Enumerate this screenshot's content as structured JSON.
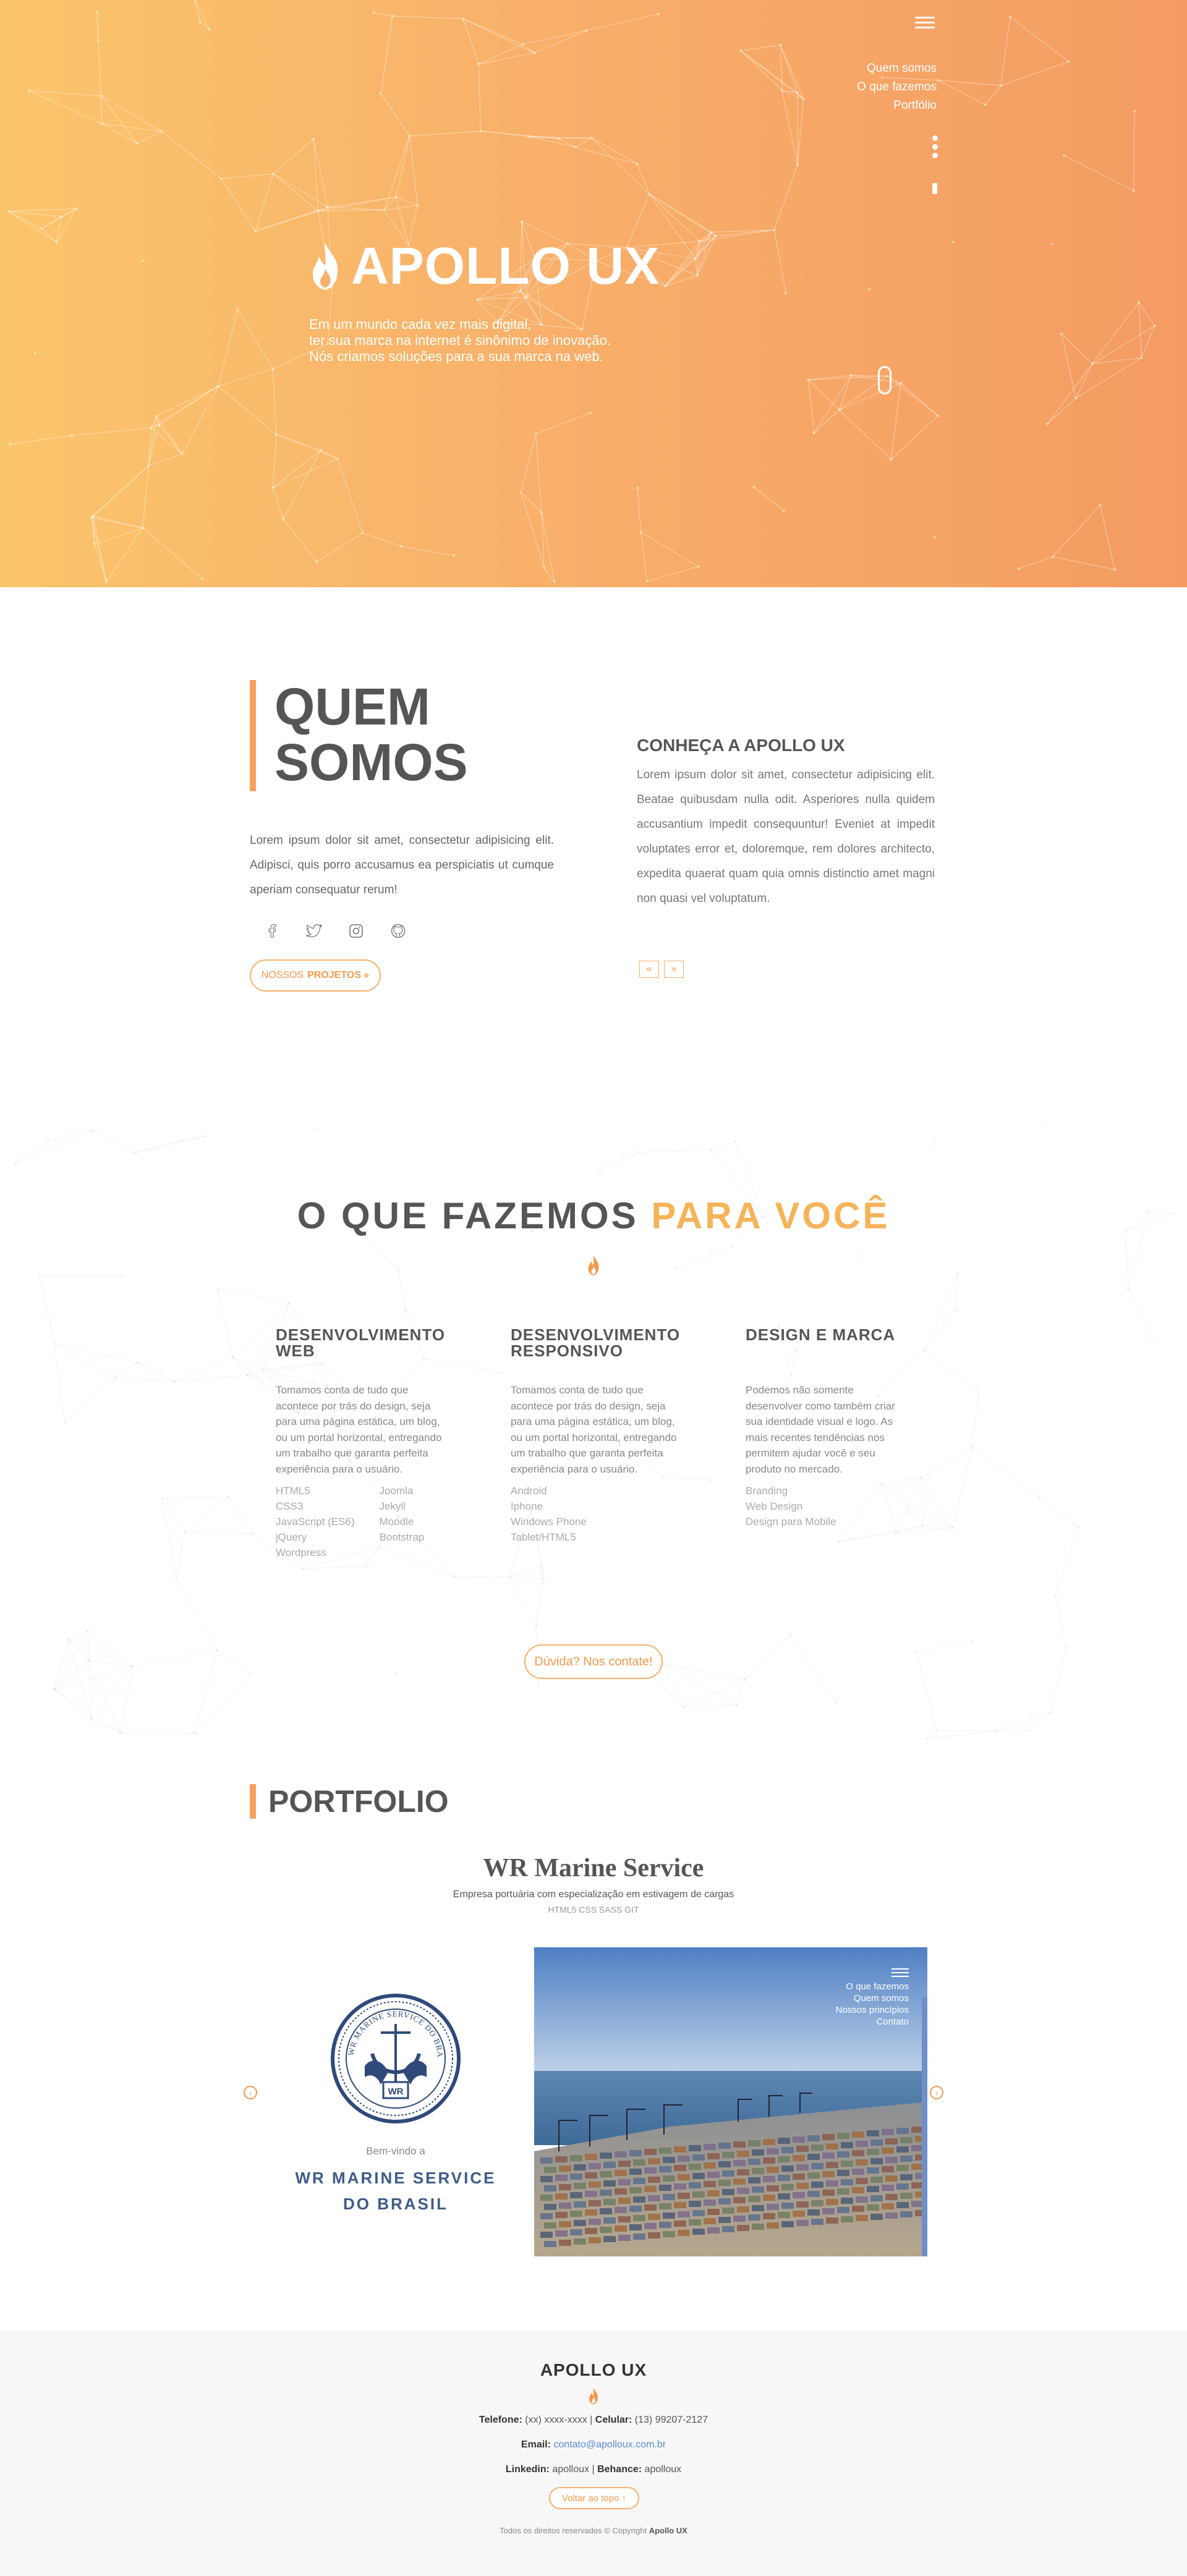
{
  "hero": {
    "brand": "APOLLO UX",
    "nav": [
      "Quem somos",
      "O que fazemos",
      "Portfólio"
    ],
    "lines": [
      "Em um mundo cada vez mais digital,",
      "ter sua marca na internet é sinônimo de inovação.",
      "Nós criamos soluções para a sua marca na web."
    ]
  },
  "about": {
    "title_line1": "QUEM",
    "title_line2": "SOMOS",
    "text": "Lorem ipsum dolor sit amet, consectetur adipisicing elit. Adipisci, quis porro accusamus ea perspiciatis ut cumque aperiam consequatur rerum!",
    "button_prefix": "NOSSOS",
    "button_label": "PROJETOS »",
    "right_title": "CONHEÇA A APOLLO UX",
    "right_text": "Lorem ipsum dolor sit amet, consectetur adipisicing elit. Beatae quibusdam nulla odit. Asperiores nulla quidem accusantium impedit consequuntur! Eveniet at impedit voluptates error et, doloremque, rem dolores architecto, expedita quaerat quam quia omnis distinctio amet magni non quasi vel voluptatum.",
    "prev": "«",
    "next": "»"
  },
  "services": {
    "title": "O QUE FAZEMOS",
    "title_accent": "PARA VOCÊ",
    "columns": [
      {
        "heading": "DESENVOLVIMENTO WEB",
        "text": "Tomamos conta de tudo que acontece por trás do design, seja para uma página estática, um blog, ou um portal horizontal, entregando um trabalho que garanta perfeita experiência para o usuário.",
        "list_a": [
          "HTML5",
          "CSS3",
          "JavaScript (ES6)",
          "jQuery",
          "Wordpress"
        ],
        "list_b": [
          "Joomla",
          "Jekyll",
          "Moodle",
          "Bootstrap"
        ]
      },
      {
        "heading": "DESENVOLVIMENTO RESPONSIVO",
        "text": "Tomamos conta de tudo que acontece por trás do design, seja para uma página estática, um blog, ou um portal horizontal, entregando um trabalho que garanta perfeita experiência para o usuário.",
        "list_a": [
          "Android",
          "Iphone",
          "Windows Phone",
          "Tablet/HTML5"
        ]
      },
      {
        "heading": "DESIGN E MARCA",
        "text": "Podemos não somente desenvolver como também criar sua identidade visual e logo. As mais recentes tendências nos permitem ajudar você e seu produto no mercado.",
        "list_a": [
          "Branding",
          "Web Design",
          "Design para Mobile"
        ]
      }
    ],
    "button": "Dúvida? Nos contate!"
  },
  "portfolio": {
    "title": "PORTFOLIO",
    "project_name": "WR Marine Service",
    "project_desc": "Empresa portuária com especialização em estivagem de cargas",
    "project_tags": "HTML5 CSS SASS GIT",
    "welcome": "Bem-vindo a",
    "company_line1": "WR MARINE SERVICE",
    "company_line2": "DO BRASIL",
    "seal_text": "WR MARINE SERVICE DO BRASIL",
    "seal_initials": "WR",
    "shot_nav": [
      "O que fazemos",
      "Quem somos",
      "Nossos princípios",
      "Contato"
    ]
  },
  "footer": {
    "title": "APOLLO UX",
    "tel_label": "Telefone:",
    "tel": "(xx) xxxx-xxxx",
    "cel_label": "Celular:",
    "cel": "(13) 99207-2127",
    "email_label": "Email:",
    "email": "contato@apolloux.com.br",
    "linkedin_label": "Linkedin:",
    "linkedin": "apolloux",
    "behance_label": "Behance:",
    "behance": "apolloux",
    "back_top": "Voltar ao topo ↑",
    "copyright": "Todos os direitos reservados © Copyright",
    "copyright_brand": "Apollo UX"
  },
  "colors": {
    "accent": "#f6b358",
    "orange": "#f39a4c",
    "hero_start": "#fbc56c",
    "hero_end": "#f49b63",
    "navy": "#3d5a8a"
  }
}
